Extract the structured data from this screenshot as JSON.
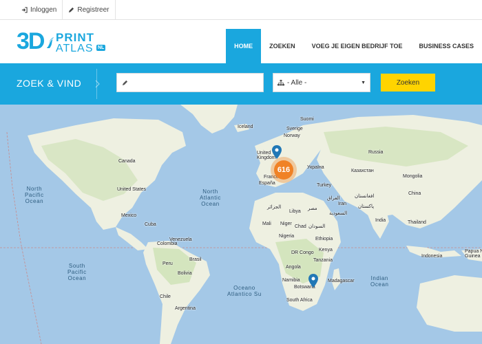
{
  "topbar": {
    "login_label": "Inloggen",
    "register_label": "Registreer"
  },
  "logo": {
    "big": "3D",
    "print": "PRINT",
    "atlas": "ATLAS",
    "tld": "NL"
  },
  "nav": {
    "items": [
      {
        "label": "HOME",
        "active": true
      },
      {
        "label": "ZOEKEN",
        "active": false
      },
      {
        "label": "VOEG JE EIGEN BEDRIJF TOE",
        "active": false
      },
      {
        "label": "BUSINESS CASES",
        "active": false
      }
    ]
  },
  "search": {
    "title": "ZOEK & VIND",
    "keyword_value": "",
    "category_selected": "- Alle -",
    "submit_label": "Zoeken"
  },
  "map": {
    "cluster_count": "616",
    "oceans": {
      "north_pacific": "North\nPacific\nOcean",
      "north_atlantic": "North\nAtlantic\nOcean",
      "south_pacific": "South\nPacific\nOcean",
      "south_atlantic": "Oceano\nAtlantico Su",
      "indian": "Indian\nOcean"
    },
    "places": {
      "iceland": "Iceland",
      "sweden": "Sverige",
      "norway": "Norway",
      "suomi": "Suomi",
      "united_kingdom": "United\nKingdom",
      "france": "France",
      "espana": "España",
      "ukraine": "Україна",
      "russia": "Russia",
      "kazakhstan": "Казахстан",
      "mongolia": "Mongolia",
      "china": "China",
      "turkey": "Turkey",
      "iran": "Iran",
      "iraq": "العراق",
      "saudi": "السعودية",
      "pakistan": "پاکستان",
      "india": "India",
      "thailand": "Thailand",
      "afghanistan": "افغانستان",
      "algeria": "الجزائر",
      "libya": "Libya",
      "egypt": "مصر",
      "mali": "Mali",
      "niger": "Niger",
      "chad": "Chad",
      "sudan": "السودان",
      "ethiopia": "Ethiopia",
      "nigeria": "Nigeria",
      "kenya": "Kenya",
      "tanzania": "Tanzania",
      "dr_congo": "DR Congo",
      "angola": "Angola",
      "namibia": "Namibia",
      "botswana": "Botswana",
      "south_africa": "South Africa",
      "madagascar": "Madagascar",
      "canada": "Canada",
      "united_states": "United States",
      "mexico": "Mexico",
      "cuba": "Cuba",
      "venezuela": "Venezuela",
      "colombia": "Colombia",
      "peru": "Peru",
      "brasil": "Brasil",
      "bolivia": "Bolivia",
      "chile": "Chile",
      "argentina": "Argentina",
      "indonesia": "Indonesia",
      "png": "Papua New\nGuinea"
    }
  },
  "colors": {
    "brand": "#1aa7de",
    "button": "#ffd400",
    "cluster": "#f08226",
    "water": "#a4c8e7",
    "land": "#eef0e1",
    "vegetation": "#c9dfaf"
  }
}
